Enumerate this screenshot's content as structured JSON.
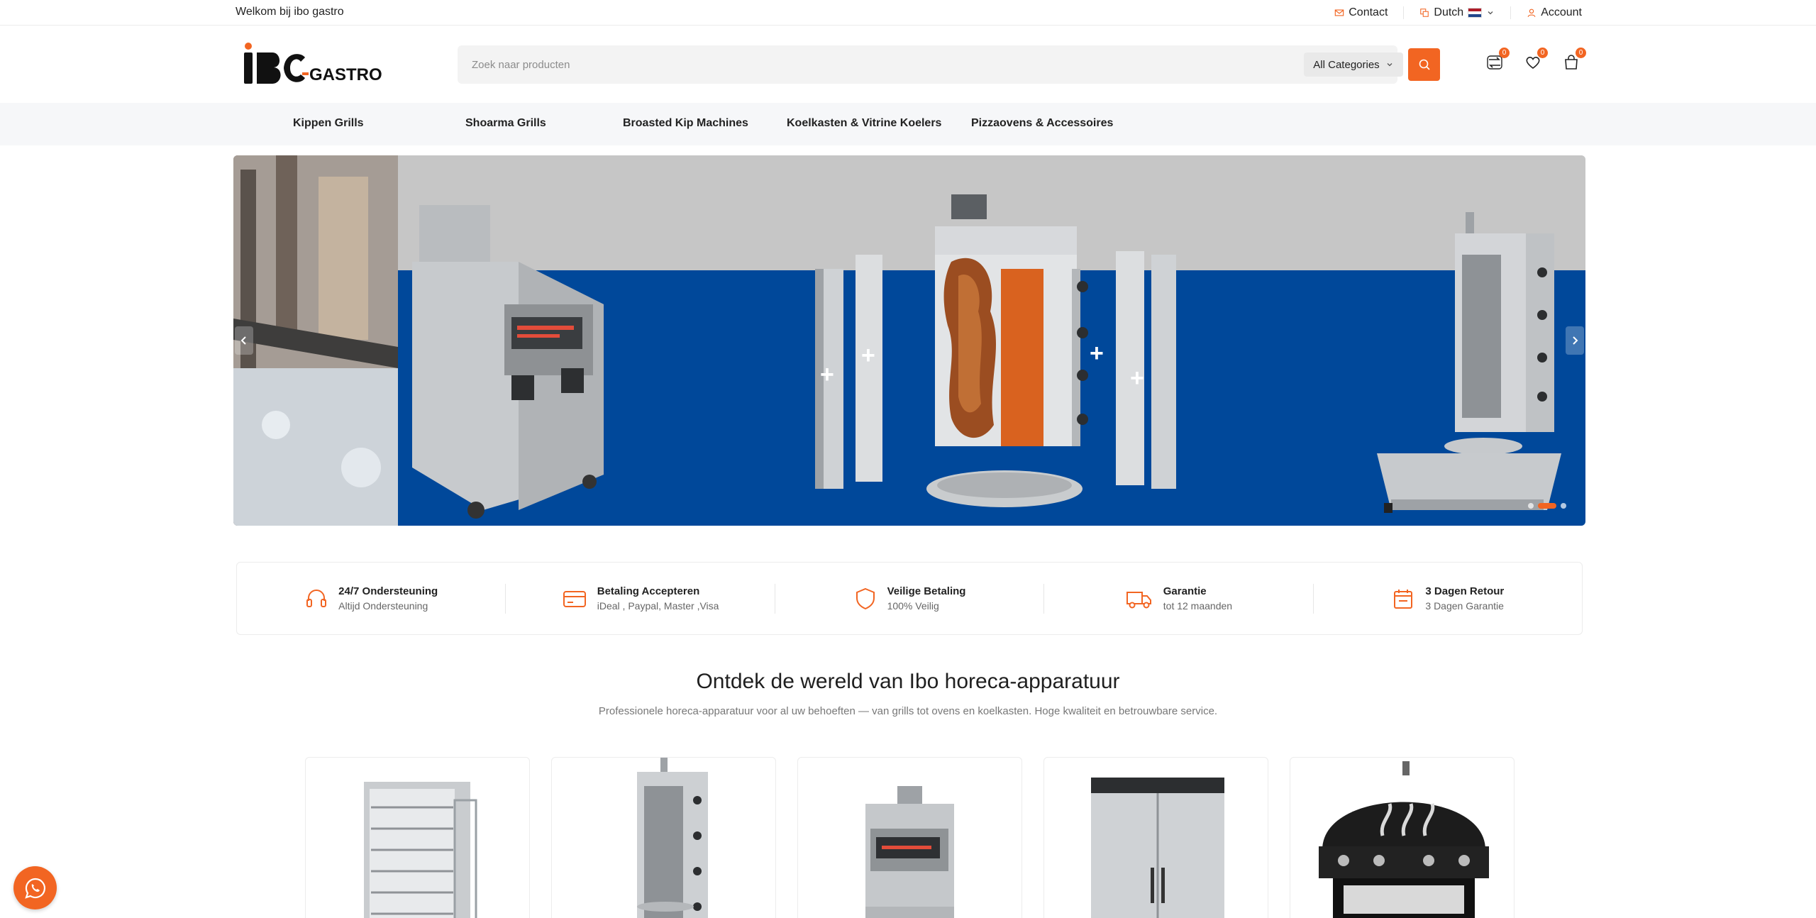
{
  "topbar": {
    "welcome": "Welkom bij ibo gastro",
    "contact": "Contact",
    "language": "Dutch",
    "account": "Account"
  },
  "header": {
    "logo_text": "IBC GASTRO",
    "search_placeholder": "Zoek naar producten",
    "category_select": "All Categories",
    "compare_count": "0",
    "wishlist_count": "0",
    "cart_count": "0"
  },
  "nav": {
    "items": [
      "Kippen Grills",
      "Shoarma Grills",
      "Broasted Kip Machines",
      "Koelkasten & Vitrine Koelers",
      "Pizzaovens & Accessoires"
    ]
  },
  "features": [
    {
      "title": "24/7 Ondersteuning",
      "subtitle": "Altijd Ondersteuning",
      "icon": "headset-icon"
    },
    {
      "title": "Betaling Accepteren",
      "subtitle": "iDeal , Paypal, Master ,Visa",
      "icon": "credit-card-icon"
    },
    {
      "title": "Veilige Betaling",
      "subtitle": "100% Veilig",
      "icon": "shield-icon"
    },
    {
      "title": "Garantie",
      "subtitle": "tot 12 maanden",
      "icon": "truck-icon"
    },
    {
      "title": "3 Dagen Retour",
      "subtitle": "3 Dagen Garantie",
      "icon": "calendar-icon"
    }
  ],
  "section": {
    "title": "Ontdek de wereld van Ibo horeca-apparatuur",
    "subtitle": "Professionele horeca-apparatuur voor al uw behoeften — van grills tot ovens en koelkasten. Hoge kwaliteit en betrouwbare service."
  },
  "hero": {
    "slide_count": 3,
    "active_slide": 2
  },
  "colors": {
    "accent": "#f26522",
    "hero_blue": "#00489a",
    "nav_bg": "#f6f7f9"
  }
}
